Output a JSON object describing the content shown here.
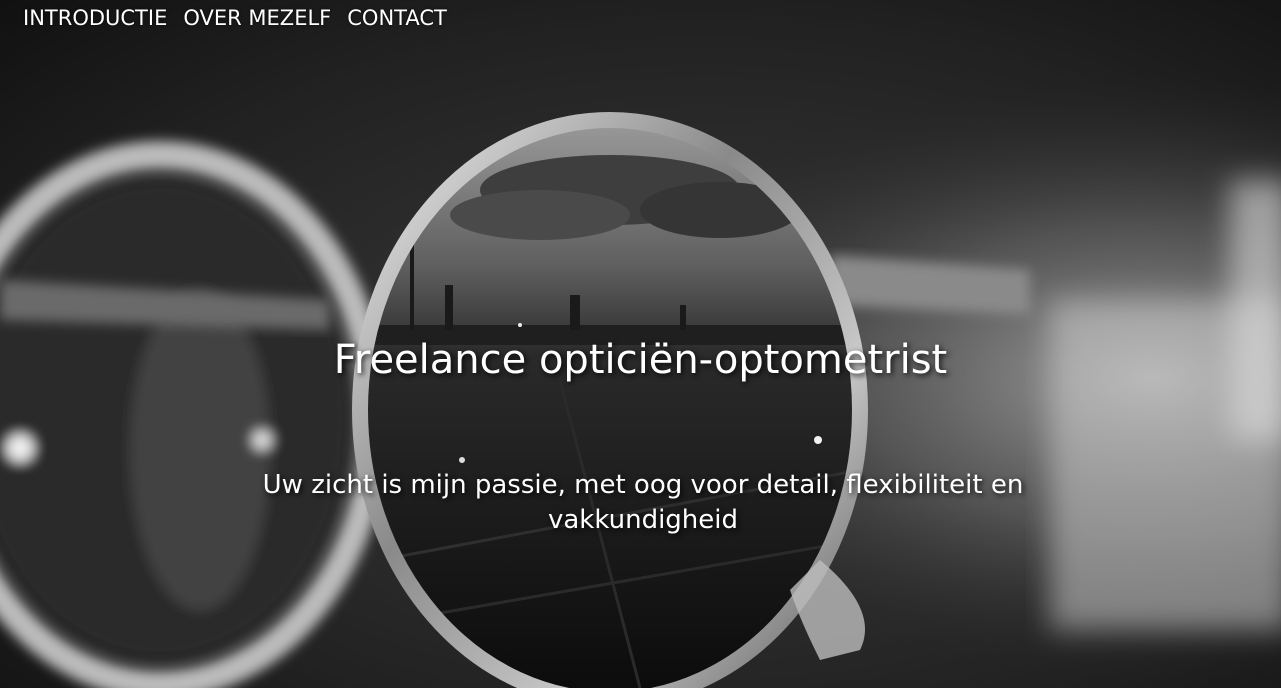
{
  "nav": {
    "items": [
      {
        "label": "INTRODUCTIE"
      },
      {
        "label": "OVER MEZELF"
      },
      {
        "label": "CONTACT"
      }
    ]
  },
  "hero": {
    "title": "Freelance opticiën-optometrist",
    "subtitle": "Uw zicht is mijn passie, met oog voor detail, flexibiliteit en vakkundigheid",
    "background_image": "black-and-white photo of round eyeglasses reflecting a city skyline"
  },
  "colors": {
    "text": "#ffffff",
    "background": "#1a1a1a"
  }
}
